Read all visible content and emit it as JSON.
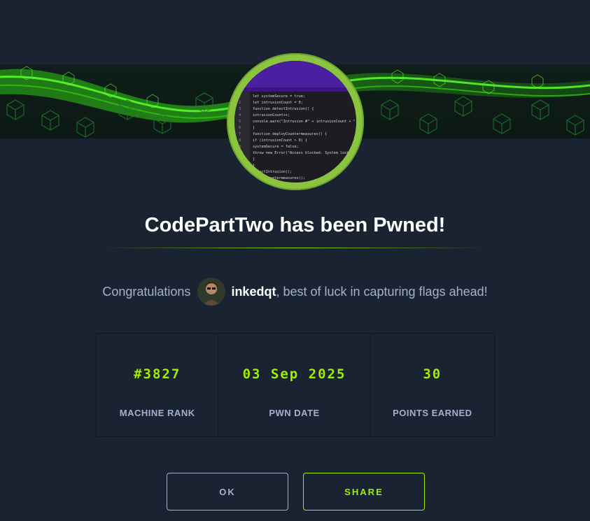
{
  "modal": {
    "title": "CodePartTwo has been Pwned!",
    "congrats_prefix": "Congratulations",
    "username": "inkedqt",
    "congrats_suffix": ", best of luck in capturing flags ahead!"
  },
  "machine_image": {
    "code_lines": [
      {
        "num": "1",
        "text": "let systemSecure = true;"
      },
      {
        "num": "2",
        "text": "let intrusionCount = 0;"
      },
      {
        "num": "3",
        "text": "function detectIntrusion() {"
      },
      {
        "num": "4",
        "text": "  intrusionCount++;"
      },
      {
        "num": "5",
        "text": "  console.warn(\"Intrusion #\" + intrusionCount + \" detected\");"
      },
      {
        "num": "6",
        "text": "}"
      },
      {
        "num": "7",
        "text": "function deployCountermeasures() {"
      },
      {
        "num": "8",
        "text": "  if (intrusionCount > 0) {"
      },
      {
        "num": "9",
        "text": "    systemSecure = false;"
      },
      {
        "num": "10",
        "text": "    throw new Error(\"Access blocked. System lockdown\");"
      },
      {
        "num": "11",
        "text": "  }"
      },
      {
        "num": "12",
        "text": "}"
      },
      {
        "num": "13",
        "text": "detectIntrusion();"
      },
      {
        "num": "14",
        "text": "deployCountermeasures();"
      }
    ]
  },
  "stats": [
    {
      "value": "#3827",
      "label": "MACHINE RANK"
    },
    {
      "value": "03 Sep 2025",
      "label": "PWN DATE"
    },
    {
      "value": "30",
      "label": "POINTS EARNED"
    }
  ],
  "buttons": {
    "ok": "OK",
    "share": "SHARE"
  },
  "colors": {
    "background": "#1a2332",
    "accent": "#9fef00",
    "ring": "#8bc53f",
    "muted_text": "#a4b1cd"
  }
}
